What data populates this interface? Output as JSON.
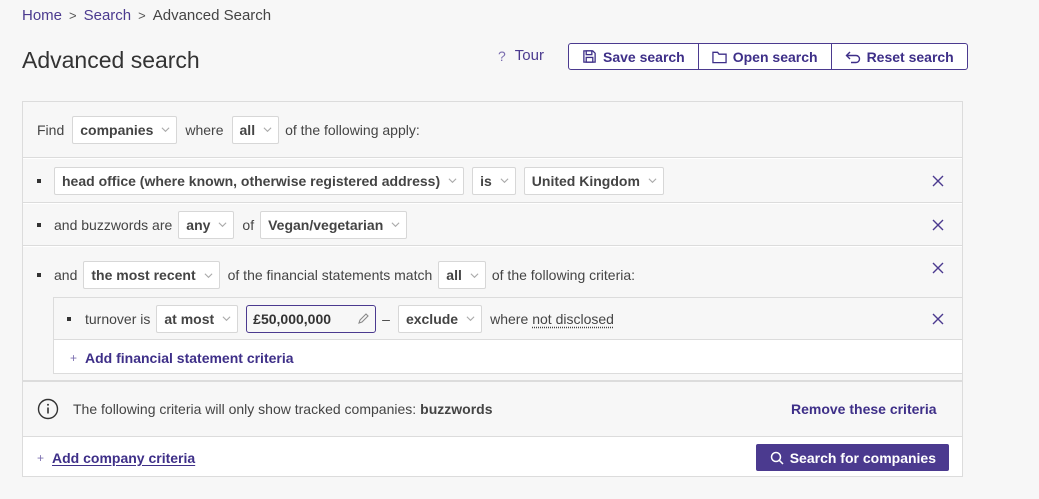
{
  "breadcrumb": {
    "home": "Home",
    "search": "Search",
    "current": "Advanced Search",
    "sep": ">"
  },
  "page": {
    "title": "Advanced search"
  },
  "toolbar": {
    "tour": "Tour",
    "tour_icon": "?",
    "save": "Save search",
    "open": "Open search",
    "reset": "Reset search"
  },
  "find": {
    "prefix": "Find",
    "entity": "companies",
    "where": "where",
    "quantifier": "all",
    "suffix": "of the following apply:"
  },
  "criteria": {
    "location": {
      "field": "head office (where known, otherwise registered address)",
      "op": "is",
      "value": "United Kingdom"
    },
    "buzzwords": {
      "prefix": "and buzzwords are",
      "quantifier": "any",
      "of": "of",
      "value": "Vegan/vegetarian"
    },
    "financial": {
      "and": "and",
      "period": "the most recent",
      "middle": "of the financial statements match",
      "quantifier": "all",
      "suffix": "of the following criteria:",
      "turnover": {
        "label": "turnover is",
        "op": "at most",
        "value": "£50,000,000",
        "dash": "–",
        "mode": "exclude",
        "where": "where",
        "not_disclosed": "not disclosed"
      },
      "add_label": "Add financial statement criteria",
      "add_icon": "+"
    }
  },
  "info": {
    "text": "The following criteria will only show tracked companies:",
    "term": "buzzwords",
    "remove": "Remove these criteria"
  },
  "footer": {
    "add_icon": "+",
    "add_company": "Add company criteria",
    "search": "Search for companies"
  },
  "colors": {
    "accent": "#4b3a8f",
    "background": "#f7f7f7",
    "border": "#dcdcdc"
  }
}
